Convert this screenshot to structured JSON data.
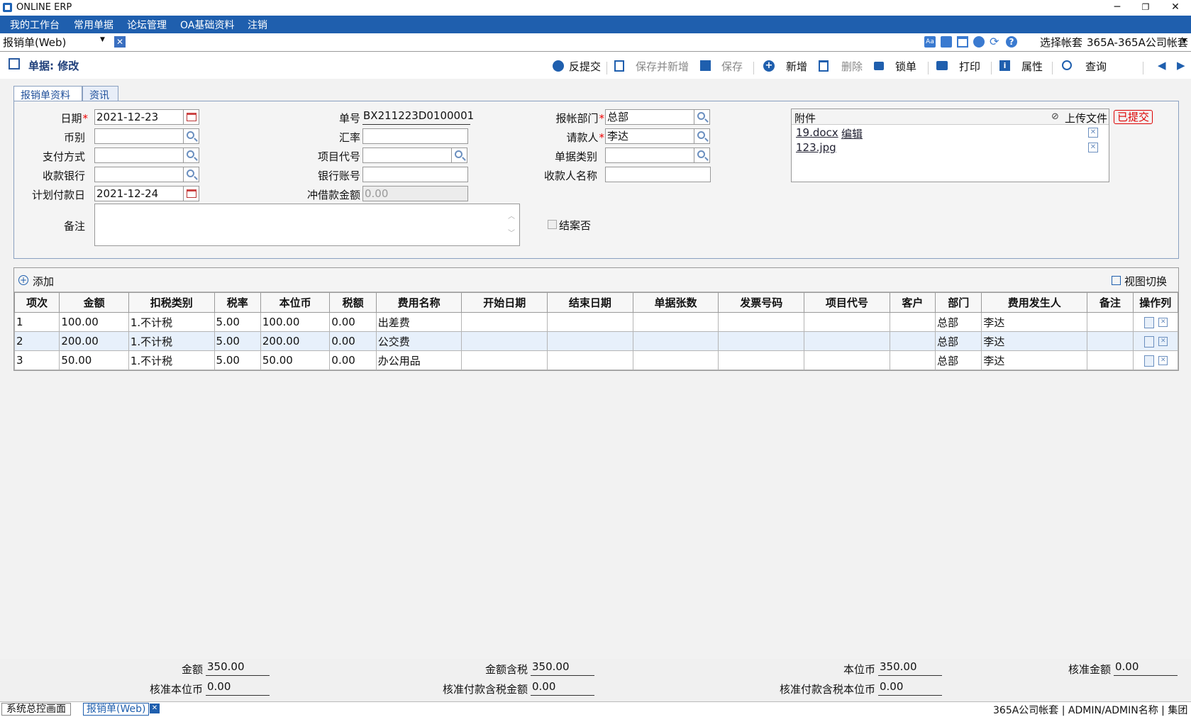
{
  "window": {
    "title": "ONLINE ERP"
  },
  "menu": [
    "我的工作台",
    "常用单据",
    "论坛管理",
    "OA基础资料",
    "注销"
  ],
  "docbar": {
    "current_doc": "报销单(Web)",
    "select_account_label": "选择帐套",
    "account_value": "365A-365A公司帐套"
  },
  "header": {
    "title": "单据: 修改"
  },
  "toolbar": {
    "unsubmit": "反提交",
    "save_new": "保存并新增",
    "save": "保存",
    "add": "新增",
    "delete": "删除",
    "lock": "锁单",
    "print": "打印",
    "props": "属性",
    "query": "查询"
  },
  "tabs": [
    "报销单资料",
    "资讯"
  ],
  "form": {
    "date_label": "日期",
    "date": "2021-12-23",
    "currency_label": "币别",
    "currency": "",
    "paymethod_label": "支付方式",
    "paymethod": "",
    "bank_label": "收款银行",
    "bank": "",
    "plan_date_label": "计划付款日",
    "plan_date": "2021-12-24",
    "remark_label": "备注",
    "remark": "",
    "docno_label": "单号",
    "docno": "BX211223D0100001",
    "rate_label": "汇率",
    "rate": "",
    "project_label": "项目代号",
    "project": "",
    "account_label": "银行账号",
    "account": "",
    "offset_label": "冲借款金额",
    "offset": "0.00",
    "dept_label": "报帐部门",
    "dept": "总部",
    "applicant_label": "请款人",
    "applicant": "李达",
    "doctype_label": "单据类别",
    "doctype": "",
    "payee_label": "收款人名称",
    "payee": "",
    "closed_label": "结案否"
  },
  "attachments": {
    "title": "附件",
    "upload": "上传文件",
    "status": "已提交",
    "files": [
      {
        "name": "19.docx",
        "edit": "编辑"
      },
      {
        "name": "123.jpg"
      }
    ]
  },
  "grid": {
    "add_label": "添加",
    "view_switch": "视图切换",
    "columns": [
      "项次",
      "金额",
      "扣税类别",
      "税率",
      "本位币",
      "税额",
      "费用名称",
      "开始日期",
      "结束日期",
      "单据张数",
      "发票号码",
      "项目代号",
      "客户",
      "部门",
      "费用发生人",
      "备注",
      "操作列"
    ],
    "rows": [
      [
        "1",
        "100.00",
        "1.不计税",
        "5.00",
        "100.00",
        "0.00",
        "出差费",
        "",
        "",
        "",
        "",
        "",
        "",
        "总部",
        "李达",
        ""
      ],
      [
        "2",
        "200.00",
        "1.不计税",
        "5.00",
        "200.00",
        "0.00",
        "公交费",
        "",
        "",
        "",
        "",
        "",
        "",
        "总部",
        "李达",
        ""
      ],
      [
        "3",
        "50.00",
        "1.不计税",
        "5.00",
        "50.00",
        "0.00",
        "办公用品",
        "",
        "",
        "",
        "",
        "",
        "",
        "总部",
        "李达",
        ""
      ]
    ]
  },
  "totals": {
    "amount_label": "金额",
    "amount": "350.00",
    "amount_tax_label": "金额含税",
    "amount_tax": "350.00",
    "base_label": "本位币",
    "base": "350.00",
    "approved_label": "核准金额",
    "approved": "0.00",
    "approved_base_label": "核准本位币",
    "approved_base": "0.00",
    "approved_pay_tax_label": "核准付款含税金额",
    "approved_pay_tax": "0.00",
    "approved_pay_tax_base_label": "核准付款含税本位币",
    "approved_pay_tax_base": "0.00"
  },
  "status": {
    "tab1": "系统总控画面",
    "tab2": "报销单(Web)",
    "right": "365A公司帐套 | ADMIN/ADMIN名称 | 集团"
  },
  "colors": {
    "menu": "#1f5fae",
    "accent": "#1e63b5",
    "required": "#e00000"
  }
}
